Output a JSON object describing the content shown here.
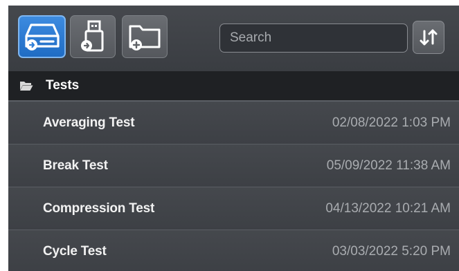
{
  "toolbar": {
    "buttons": [
      {
        "icon": "internal-drive-icon",
        "selected": true
      },
      {
        "icon": "usb-drive-icon",
        "selected": false
      },
      {
        "icon": "new-folder-icon",
        "selected": false
      }
    ],
    "search": {
      "placeholder": "Search",
      "value": ""
    },
    "sort_icon": "sort-arrows-icon"
  },
  "folder": {
    "icon": "open-folder-icon",
    "name": "Tests"
  },
  "items": [
    {
      "name": "Averaging Test",
      "date": "02/08/2022 1:03 PM"
    },
    {
      "name": "Break Test",
      "date": "05/09/2022 11:38 AM"
    },
    {
      "name": "Compression Test",
      "date": "04/13/2022 10:21 AM"
    },
    {
      "name": "Cycle Test",
      "date": "03/03/2022 5:20 PM"
    }
  ],
  "colors": {
    "accent": "#2f7fd8",
    "panel_bg": "#3c3f44",
    "header_bg": "#1f2124",
    "date_text": "#a9acb0"
  }
}
